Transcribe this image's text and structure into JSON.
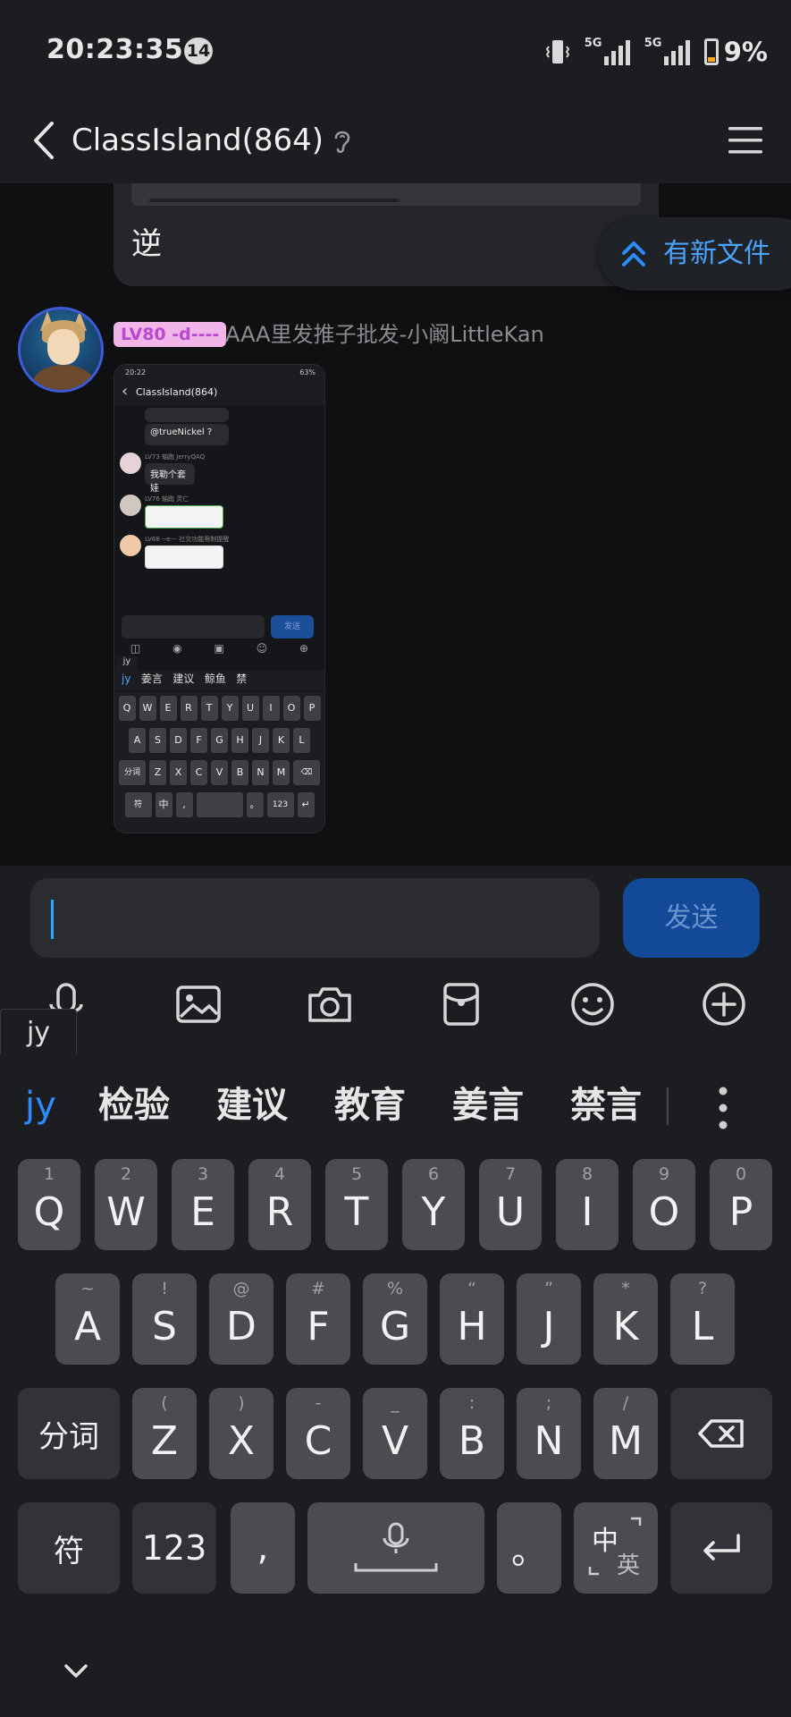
{
  "status_bar": {
    "time": "20:23:35",
    "notification_count": "14",
    "battery_percent": "9%",
    "network_1": "5G",
    "network_2": "5G"
  },
  "header": {
    "title": "ClassIsland(864)"
  },
  "chat": {
    "prev_message_text": "逆",
    "new_file_label": "有新文件",
    "sender_level_badge": "LV80 -d----",
    "sender_name": "AAA里发推子批发-小阚LittleKan",
    "screenshot": {
      "status_time": "20:22",
      "status_battery": "63%",
      "title": "ClassIsland(864)",
      "msg_1": "@trueNickel ?",
      "user_2_badge": "LV73 轴跑",
      "user_2_name": "JerryQAQ",
      "msg_2": "我勒个套娃",
      "user_3_badge": "LV76 轴跑",
      "user_3_name": "灵仁",
      "user_4_badge": "LV68 --e---",
      "user_4_name": "社交功能限制提醒",
      "send_label": "发送",
      "jy_tag": "jy",
      "candidates": [
        "jy",
        "姜言",
        "建议",
        "鲸鱼",
        "禁"
      ],
      "row1": [
        "Q",
        "W",
        "E",
        "R",
        "T",
        "Y",
        "U",
        "I",
        "O",
        "P"
      ],
      "row2": [
        "A",
        "S",
        "D",
        "F",
        "G",
        "H",
        "J",
        "K",
        "L"
      ],
      "row3_left": "分词",
      "row3": [
        "Z",
        "X",
        "C",
        "V",
        "B",
        "N",
        "M"
      ],
      "row4": [
        "符",
        "中",
        ",",
        "",
        "。",
        "123",
        "↵"
      ]
    }
  },
  "input": {
    "placeholder": "",
    "send_label": "发送"
  },
  "toolbar": {
    "icons": [
      "microphone-icon",
      "image-icon",
      "camera-icon",
      "red-packet-icon",
      "emoji-icon",
      "plus-icon"
    ]
  },
  "keyboard": {
    "jy_tag": "jy",
    "candidates": {
      "pinyin": "jy",
      "c1": "检验",
      "c2": "建议",
      "c3": "教育",
      "c4": "姜言",
      "c5": "禁言"
    },
    "row1": [
      {
        "sub": "1",
        "main": "Q"
      },
      {
        "sub": "2",
        "main": "W"
      },
      {
        "sub": "3",
        "main": "E"
      },
      {
        "sub": "4",
        "main": "R"
      },
      {
        "sub": "5",
        "main": "T"
      },
      {
        "sub": "6",
        "main": "Y"
      },
      {
        "sub": "7",
        "main": "U"
      },
      {
        "sub": "8",
        "main": "I"
      },
      {
        "sub": "9",
        "main": "O"
      },
      {
        "sub": "0",
        "main": "P"
      }
    ],
    "row2": [
      {
        "sub": "~",
        "main": "A"
      },
      {
        "sub": "!",
        "main": "S"
      },
      {
        "sub": "@",
        "main": "D"
      },
      {
        "sub": "#",
        "main": "F"
      },
      {
        "sub": "%",
        "main": "G"
      },
      {
        "sub": "“",
        "main": "H"
      },
      {
        "sub": "”",
        "main": "J"
      },
      {
        "sub": "*",
        "main": "K"
      },
      {
        "sub": "?",
        "main": "L"
      }
    ],
    "row3_left": "分词",
    "row3": [
      {
        "sub": "(",
        "main": "Z"
      },
      {
        "sub": ")",
        "main": "X"
      },
      {
        "sub": "-",
        "main": "C"
      },
      {
        "sub": "_",
        "main": "V"
      },
      {
        "sub": ":",
        "main": "B"
      },
      {
        "sub": ";",
        "main": "N"
      },
      {
        "sub": "/",
        "main": "M"
      }
    ],
    "symbols_label": "符",
    "numbers_label": "123",
    "comma_label": ",",
    "period_label": "。",
    "lang_cn": "中",
    "lang_en": "英"
  }
}
